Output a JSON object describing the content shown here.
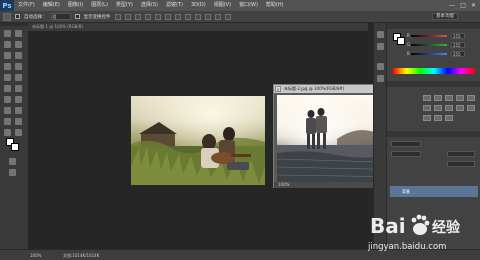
{
  "app": {
    "logo": "Ps"
  },
  "menu": [
    "文件(F)",
    "编辑(E)",
    "图像(I)",
    "图层(L)",
    "类型(Y)",
    "选择(S)",
    "滤镜(T)",
    "3D(D)",
    "视图(V)",
    "窗口(W)",
    "帮助(H)"
  ],
  "window_controls": [
    "—",
    "□",
    "✕"
  ],
  "options_bar": {
    "auto_select_label": "自动选择：",
    "auto_select_value": "组",
    "transform_label": "显示变换控件",
    "workspace": "基本功能"
  },
  "document": {
    "tab_title": "未标题-1 @ 100% (RGB/8)"
  },
  "floating_window": {
    "title": "未标题-2.jpg @ 100%(RGB/8#)",
    "close": "×",
    "zoom": "100%"
  },
  "color_panel": {
    "rows": [
      {
        "label": "R",
        "value": "255",
        "color": "#e05050"
      },
      {
        "label": "G",
        "value": "255",
        "color": "#40b040"
      },
      {
        "label": "B",
        "value": "255",
        "color": "#5080ff"
      }
    ]
  },
  "layers_panel": {
    "layer_name": "背景"
  },
  "status_bar": {
    "zoom": "100%",
    "doc_info": "文档:1014K/1014K"
  },
  "watermark": {
    "brand": "Bai",
    "brand2": "经验",
    "url": "jingyan.baidu.com"
  },
  "colors": {
    "selection": "#5a7696",
    "menubar": "#535353"
  }
}
